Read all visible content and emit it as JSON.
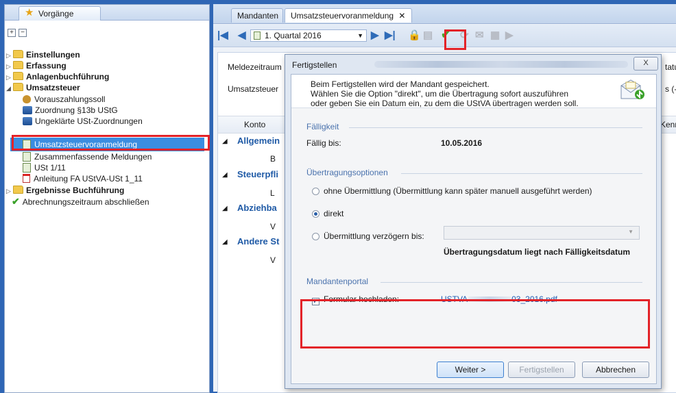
{
  "left_panel": {
    "tab_label": "Vorgänge",
    "items": [
      {
        "label": "Einstellungen"
      },
      {
        "label": "Erfassung"
      },
      {
        "label": "Anlagenbuchführung"
      },
      {
        "label": "Umsatzsteuer"
      },
      {
        "label": "Vorauszahlungssoll"
      },
      {
        "label": "Zuordnung §13b UStG"
      },
      {
        "label": "Ungeklärte USt-Zuordnungen"
      },
      {
        "label": "Umsatzsteuervoranmeldung"
      },
      {
        "label": "Zusammenfassende Meldungen"
      },
      {
        "label": "USt 1/11"
      },
      {
        "label": "Anleitung FA UStVA-USt 1_11"
      },
      {
        "label": "Ergebnisse Buchführung"
      },
      {
        "label": "Abrechnungszeitraum abschließen"
      }
    ]
  },
  "tabs": {
    "mandanten": "Mandanten",
    "active": "Umsatzsteuervoranmeldung",
    "close_glyph": "✕"
  },
  "toolbar": {
    "period": "1. Quartal 2016"
  },
  "background": {
    "meldezeitraum": "Meldezeitraum",
    "umsatzsteuer": "Umsatzsteuer",
    "konto": "Konto",
    "status_partial": "tatus",
    "s_minus": "s (-)",
    "kenn_partial": "Kenn",
    "sections": [
      "Allgemein",
      "Steuerpfli",
      "Abziehba",
      "Andere St"
    ],
    "row_letters": [
      "B",
      "L",
      "V",
      "V"
    ]
  },
  "dialog": {
    "title": "Fertigstellen",
    "close_glyph": "X",
    "intro": [
      "Beim Fertigstellen wird der Mandant gespeichert.",
      "Wählen Sie die Option \"direkt\", um die Übertragung sofort auszuführen",
      "oder geben Sie ein Datum ein, zu dem die UStVA übertragen werden soll."
    ],
    "faelligkeit": {
      "title": "Fälligkeit",
      "label": "Fällig bis:",
      "value": "10.05.2016"
    },
    "uebertragung": {
      "title": "Übertragungsoptionen",
      "options": [
        {
          "label": "ohne Übermittlung (Übermittlung kann später manuell ausgeführt werden)",
          "selected": false
        },
        {
          "label": "direkt",
          "selected": true
        },
        {
          "label": "Übermittlung verzögern bis:",
          "selected": false
        }
      ],
      "date_value": "",
      "warning": "Übertragungsdatum liegt nach Fälligkeitsdatum"
    },
    "portal": {
      "title": "Mandantenportal",
      "checkbox_label": "Formular hochladen:",
      "checked": true,
      "file_prefix": "USTVA",
      "file_suffix": "03_2016.pdf"
    },
    "buttons": {
      "next": "Weiter >",
      "finish": "Fertigstellen",
      "cancel": "Abbrechen"
    }
  },
  "colors": {
    "highlight_red": "#e32228",
    "selection_blue": "#3b8de0",
    "link_blue": "#1f5aa6"
  }
}
